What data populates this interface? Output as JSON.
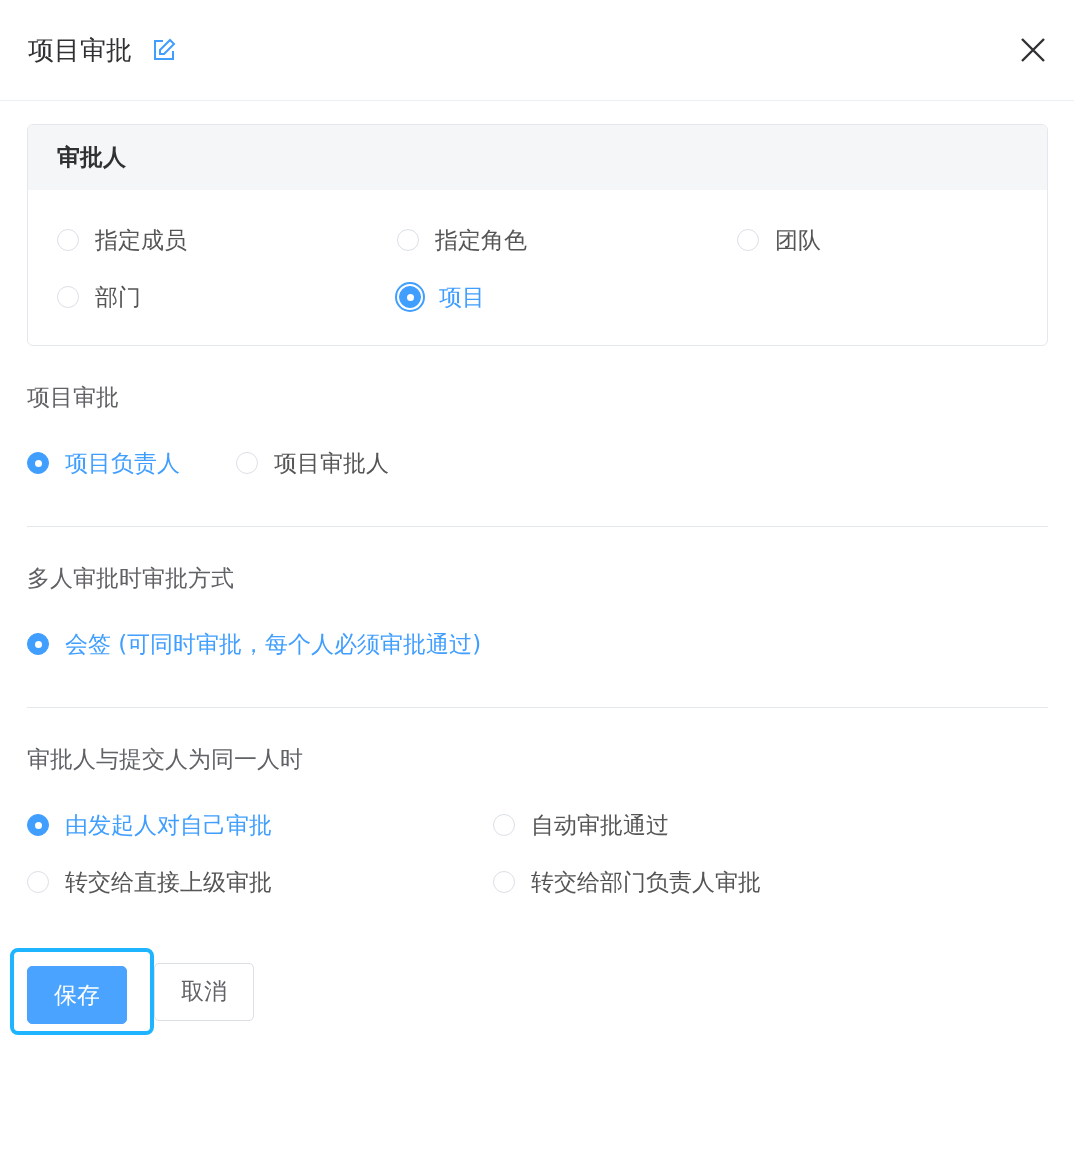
{
  "header": {
    "title": "项目审批"
  },
  "approver_card": {
    "title": "审批人",
    "options": [
      {
        "label": "指定成员",
        "selected": false,
        "focused": false
      },
      {
        "label": "指定角色",
        "selected": false,
        "focused": false
      },
      {
        "label": "团队",
        "selected": false,
        "focused": false
      },
      {
        "label": "部门",
        "selected": false,
        "focused": false
      },
      {
        "label": "项目",
        "selected": true,
        "focused": true
      }
    ]
  },
  "sections": [
    {
      "label": "项目审批",
      "kind": "inline",
      "options": [
        {
          "label": "项目负责人",
          "selected": true
        },
        {
          "label": "项目审批人",
          "selected": false
        }
      ]
    },
    {
      "label": "多人审批时审批方式",
      "kind": "inline",
      "options": [
        {
          "label": "会签 (可同时审批，每个人必须审批通过)",
          "selected": true
        }
      ]
    },
    {
      "label": "审批人与提交人为同一人时",
      "kind": "grid",
      "options": [
        {
          "label": "由发起人对自己审批",
          "selected": true
        },
        {
          "label": "自动审批通过",
          "selected": false
        },
        {
          "label": "转交给直接上级审批",
          "selected": false
        },
        {
          "label": "转交给部门负责人审批",
          "selected": false
        }
      ]
    }
  ],
  "buttons": [
    {
      "label": "保存",
      "kind": "primary",
      "focused": true
    },
    {
      "label": "取消",
      "kind": "default",
      "focused": false
    }
  ]
}
